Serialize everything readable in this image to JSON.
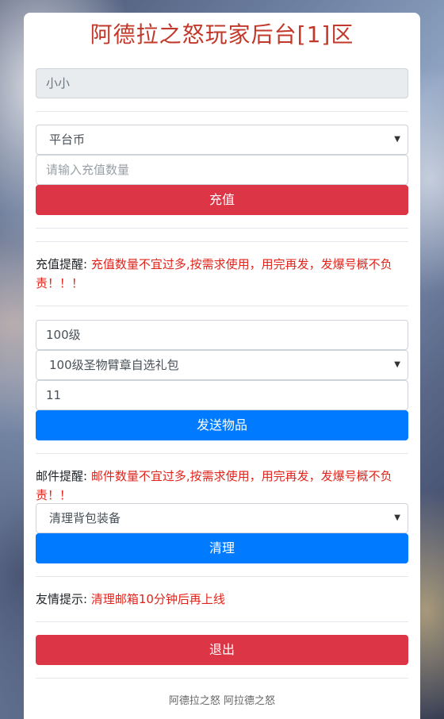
{
  "page": {
    "title": "阿德拉之怒玩家后台[1]区"
  },
  "account": {
    "username": "小小"
  },
  "recharge": {
    "currency_selected": "平台币",
    "amount_placeholder": "请输入充值数量",
    "button_label": "充值",
    "notice_label": "充值提醒:",
    "notice_text": "充值数量不宜过多,按需求使用，用完再发，发爆号概不负责！！！"
  },
  "send_item": {
    "level_value": "100级",
    "item_selected": "100级圣物臂章自选礼包",
    "quantity_value": "11",
    "button_label": "发送物品",
    "notice_label": "邮件提醒:",
    "notice_text": "邮件数量不宜过多,按需求使用，用完再发，发爆号概不负责！！"
  },
  "clear": {
    "option_selected": "清理背包装备",
    "button_label": "清理",
    "tip_label": "友情提示:",
    "tip_text": "清理邮箱10分钟后再上线"
  },
  "logout": {
    "button_label": "退出"
  },
  "footer": {
    "text": "阿德拉之怒 阿拉德之怒"
  },
  "colors": {
    "title": "#c0392b",
    "danger_button": "#dc3545",
    "primary_button": "#007bff",
    "warning_text": "#e0241b"
  }
}
